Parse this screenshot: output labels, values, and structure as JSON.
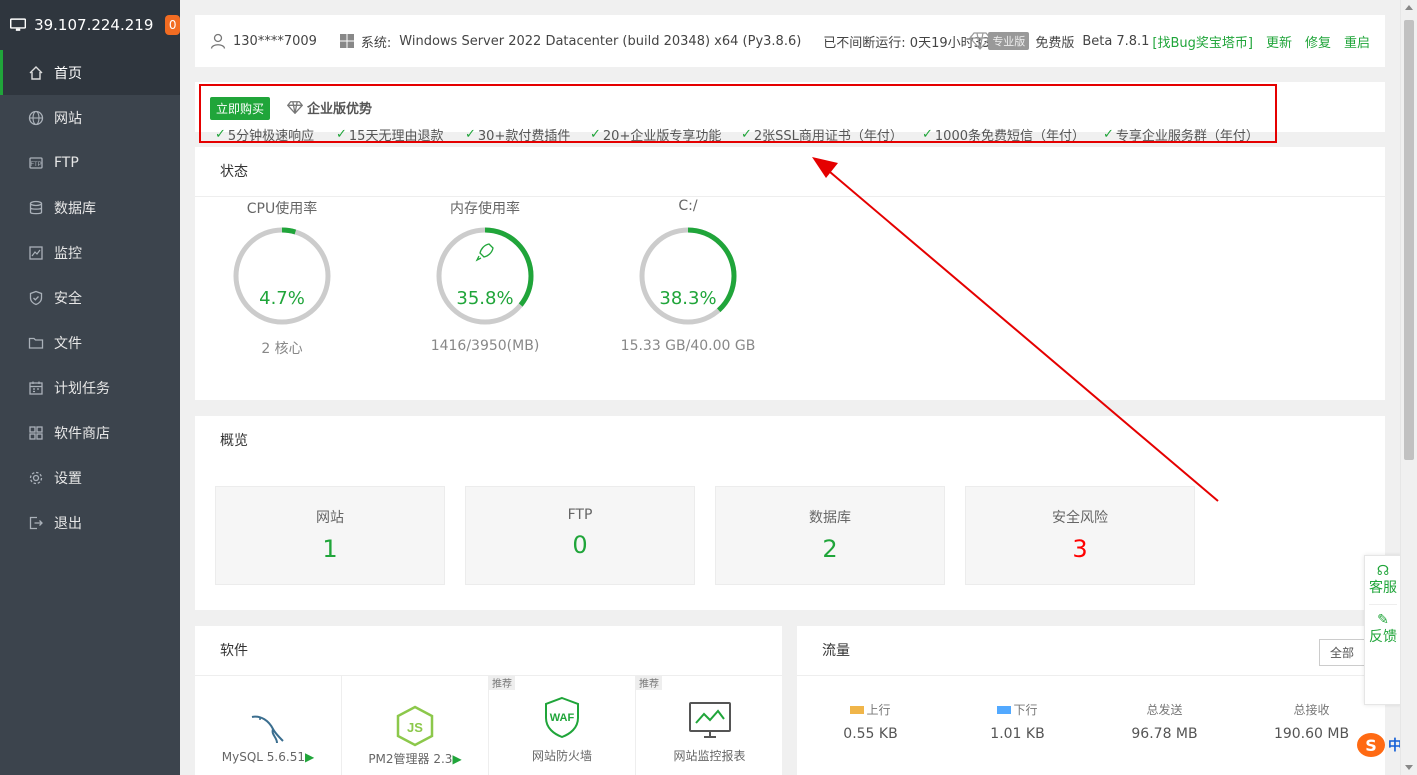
{
  "sidebar": {
    "ip": "39.107.224.219",
    "badge": "0",
    "items": [
      {
        "label": "首页",
        "icon": "home-icon"
      },
      {
        "label": "网站",
        "icon": "globe-icon"
      },
      {
        "label": "FTP",
        "icon": "ftp-icon"
      },
      {
        "label": "数据库",
        "icon": "database-icon"
      },
      {
        "label": "监控",
        "icon": "monitor-icon"
      },
      {
        "label": "安全",
        "icon": "shield-icon"
      },
      {
        "label": "文件",
        "icon": "folder-icon"
      },
      {
        "label": "计划任务",
        "icon": "calendar-icon"
      },
      {
        "label": "软件商店",
        "icon": "grid-icon"
      },
      {
        "label": "设置",
        "icon": "gear-icon"
      },
      {
        "label": "退出",
        "icon": "logout-icon"
      }
    ]
  },
  "topbar": {
    "user": "130****7009",
    "system_label": "系统:",
    "system_value": "Windows Server 2022 Datacenter (build 20348) x64 (Py3.8.6)",
    "uptime": "已不间断运行: 0天19小时33分钟",
    "pro_label": "专业版",
    "free_label": "免费版",
    "version_prefix": "Beta",
    "version": "7.8.1",
    "bug_link": "[找Bug奖宝塔币]",
    "update": "更新",
    "repair": "修复",
    "restart": "重启"
  },
  "promo": {
    "buy": "立即购买",
    "title": "企业版优势",
    "features": [
      "5分钟极速响应",
      "15天无理由退款",
      "30+款付费插件",
      "20+企业版专享功能",
      "2张SSL商用证书（年付）",
      "1000条免费短信（年付）",
      "专享企业服务群（年付）"
    ]
  },
  "status": {
    "title": "状态",
    "gauges": [
      {
        "title": "CPU使用率",
        "value": "4.7%",
        "sub": "2 核心",
        "percent": 4.7
      },
      {
        "title": "内存使用率",
        "value": "35.8%",
        "sub": "1416/3950(MB)",
        "percent": 35.8
      },
      {
        "title": "C:/",
        "value": "38.3%",
        "sub": "15.33 GB/40.00 GB",
        "percent": 38.3
      }
    ]
  },
  "overview": {
    "title": "概览",
    "items": [
      {
        "label": "网站",
        "value": "1",
        "color": "#20a53a"
      },
      {
        "label": "FTP",
        "value": "0",
        "color": "#20a53a"
      },
      {
        "label": "数据库",
        "value": "2",
        "color": "#20a53a"
      },
      {
        "label": "安全风险",
        "value": "3",
        "color": "#ff0000"
      }
    ]
  },
  "software": {
    "title": "软件",
    "items": [
      {
        "name": "MySQL 5.6.51",
        "icon": "mysql-icon",
        "rec": ""
      },
      {
        "name": "PM2管理器 2.3",
        "icon": "nodejs-icon",
        "rec": ""
      },
      {
        "name": "网站防火墙",
        "icon": "waf-icon",
        "rec": "推荐"
      },
      {
        "name": "网站监控报表",
        "icon": "monitor-report-icon",
        "rec": "推荐"
      }
    ]
  },
  "traffic": {
    "title": "流量",
    "range": "全部",
    "items": [
      {
        "label": "上行",
        "value": "0.55 KB",
        "color": "#f0b549"
      },
      {
        "label": "下行",
        "value": "1.01 KB",
        "color": "#52a9ff"
      },
      {
        "label": "总发送",
        "value": "96.78 MB",
        "color": ""
      },
      {
        "label": "总接收",
        "value": "190.60 MB",
        "color": ""
      }
    ]
  },
  "float": {
    "service": "客服",
    "feedback": "反馈"
  },
  "ime": {
    "logo": "S",
    "lang": "中"
  },
  "accent": "#20a53a",
  "annotation_color": "#e50000"
}
